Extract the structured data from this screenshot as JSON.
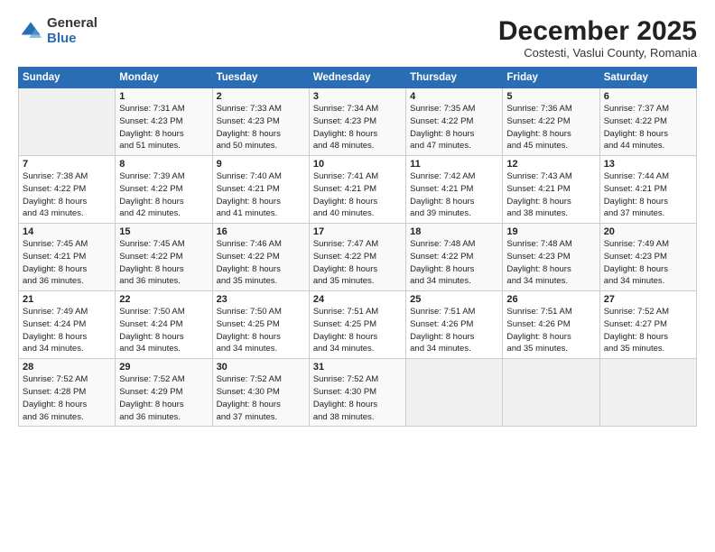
{
  "logo": {
    "general": "General",
    "blue": "Blue"
  },
  "header": {
    "month": "December 2025",
    "location": "Costesti, Vaslui County, Romania"
  },
  "days_of_week": [
    "Sunday",
    "Monday",
    "Tuesday",
    "Wednesday",
    "Thursday",
    "Friday",
    "Saturday"
  ],
  "weeks": [
    [
      {
        "num": "",
        "info": ""
      },
      {
        "num": "1",
        "info": "Sunrise: 7:31 AM\nSunset: 4:23 PM\nDaylight: 8 hours\nand 51 minutes."
      },
      {
        "num": "2",
        "info": "Sunrise: 7:33 AM\nSunset: 4:23 PM\nDaylight: 8 hours\nand 50 minutes."
      },
      {
        "num": "3",
        "info": "Sunrise: 7:34 AM\nSunset: 4:23 PM\nDaylight: 8 hours\nand 48 minutes."
      },
      {
        "num": "4",
        "info": "Sunrise: 7:35 AM\nSunset: 4:22 PM\nDaylight: 8 hours\nand 47 minutes."
      },
      {
        "num": "5",
        "info": "Sunrise: 7:36 AM\nSunset: 4:22 PM\nDaylight: 8 hours\nand 45 minutes."
      },
      {
        "num": "6",
        "info": "Sunrise: 7:37 AM\nSunset: 4:22 PM\nDaylight: 8 hours\nand 44 minutes."
      }
    ],
    [
      {
        "num": "7",
        "info": "Sunrise: 7:38 AM\nSunset: 4:22 PM\nDaylight: 8 hours\nand 43 minutes."
      },
      {
        "num": "8",
        "info": "Sunrise: 7:39 AM\nSunset: 4:22 PM\nDaylight: 8 hours\nand 42 minutes."
      },
      {
        "num": "9",
        "info": "Sunrise: 7:40 AM\nSunset: 4:21 PM\nDaylight: 8 hours\nand 41 minutes."
      },
      {
        "num": "10",
        "info": "Sunrise: 7:41 AM\nSunset: 4:21 PM\nDaylight: 8 hours\nand 40 minutes."
      },
      {
        "num": "11",
        "info": "Sunrise: 7:42 AM\nSunset: 4:21 PM\nDaylight: 8 hours\nand 39 minutes."
      },
      {
        "num": "12",
        "info": "Sunrise: 7:43 AM\nSunset: 4:21 PM\nDaylight: 8 hours\nand 38 minutes."
      },
      {
        "num": "13",
        "info": "Sunrise: 7:44 AM\nSunset: 4:21 PM\nDaylight: 8 hours\nand 37 minutes."
      }
    ],
    [
      {
        "num": "14",
        "info": "Sunrise: 7:45 AM\nSunset: 4:21 PM\nDaylight: 8 hours\nand 36 minutes."
      },
      {
        "num": "15",
        "info": "Sunrise: 7:45 AM\nSunset: 4:22 PM\nDaylight: 8 hours\nand 36 minutes."
      },
      {
        "num": "16",
        "info": "Sunrise: 7:46 AM\nSunset: 4:22 PM\nDaylight: 8 hours\nand 35 minutes."
      },
      {
        "num": "17",
        "info": "Sunrise: 7:47 AM\nSunset: 4:22 PM\nDaylight: 8 hours\nand 35 minutes."
      },
      {
        "num": "18",
        "info": "Sunrise: 7:48 AM\nSunset: 4:22 PM\nDaylight: 8 hours\nand 34 minutes."
      },
      {
        "num": "19",
        "info": "Sunrise: 7:48 AM\nSunset: 4:23 PM\nDaylight: 8 hours\nand 34 minutes."
      },
      {
        "num": "20",
        "info": "Sunrise: 7:49 AM\nSunset: 4:23 PM\nDaylight: 8 hours\nand 34 minutes."
      }
    ],
    [
      {
        "num": "21",
        "info": "Sunrise: 7:49 AM\nSunset: 4:24 PM\nDaylight: 8 hours\nand 34 minutes."
      },
      {
        "num": "22",
        "info": "Sunrise: 7:50 AM\nSunset: 4:24 PM\nDaylight: 8 hours\nand 34 minutes."
      },
      {
        "num": "23",
        "info": "Sunrise: 7:50 AM\nSunset: 4:25 PM\nDaylight: 8 hours\nand 34 minutes."
      },
      {
        "num": "24",
        "info": "Sunrise: 7:51 AM\nSunset: 4:25 PM\nDaylight: 8 hours\nand 34 minutes."
      },
      {
        "num": "25",
        "info": "Sunrise: 7:51 AM\nSunset: 4:26 PM\nDaylight: 8 hours\nand 34 minutes."
      },
      {
        "num": "26",
        "info": "Sunrise: 7:51 AM\nSunset: 4:26 PM\nDaylight: 8 hours\nand 35 minutes."
      },
      {
        "num": "27",
        "info": "Sunrise: 7:52 AM\nSunset: 4:27 PM\nDaylight: 8 hours\nand 35 minutes."
      }
    ],
    [
      {
        "num": "28",
        "info": "Sunrise: 7:52 AM\nSunset: 4:28 PM\nDaylight: 8 hours\nand 36 minutes."
      },
      {
        "num": "29",
        "info": "Sunrise: 7:52 AM\nSunset: 4:29 PM\nDaylight: 8 hours\nand 36 minutes."
      },
      {
        "num": "30",
        "info": "Sunrise: 7:52 AM\nSunset: 4:30 PM\nDaylight: 8 hours\nand 37 minutes."
      },
      {
        "num": "31",
        "info": "Sunrise: 7:52 AM\nSunset: 4:30 PM\nDaylight: 8 hours\nand 38 minutes."
      },
      {
        "num": "",
        "info": ""
      },
      {
        "num": "",
        "info": ""
      },
      {
        "num": "",
        "info": ""
      }
    ]
  ]
}
